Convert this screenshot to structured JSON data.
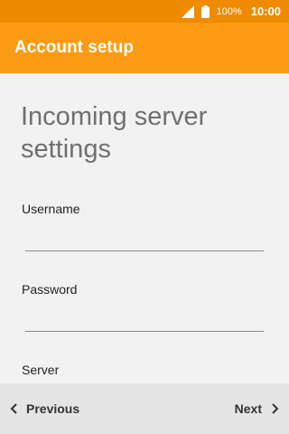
{
  "status_bar": {
    "battery_percent": "100%",
    "time": "10:00",
    "icons": [
      "signal-icon",
      "battery-icon"
    ]
  },
  "app_bar": {
    "title": "Account setup"
  },
  "form": {
    "heading": "Incoming server settings",
    "username_label": "Username",
    "username_value": "",
    "password_label": "Password",
    "password_value": "",
    "server_label": "Server"
  },
  "navigation": {
    "previous_label": "Previous",
    "next_label": "Next",
    "icons": [
      "chevron-left-icon",
      "chevron-right-icon"
    ]
  },
  "colors": {
    "status_bar": "#f08a00",
    "app_bar": "#fb9b13",
    "background": "#f2f2f2",
    "bottom_bar": "#e5e5e5"
  }
}
